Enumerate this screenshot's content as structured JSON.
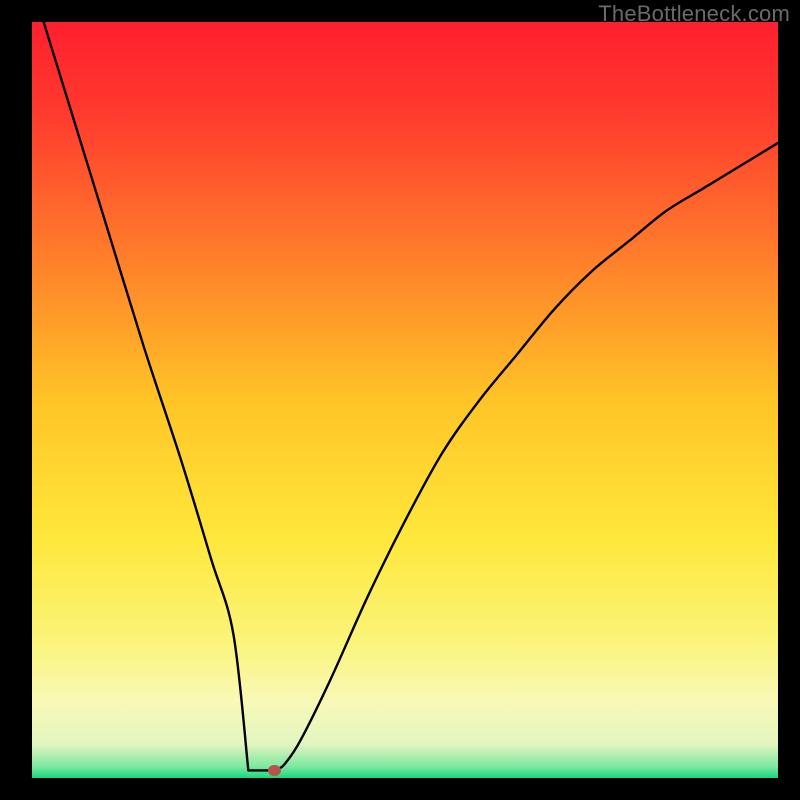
{
  "watermark": "TheBottleneck.com",
  "chart_data": {
    "type": "line",
    "title": "",
    "xlabel": "",
    "ylabel": "",
    "xlim": [
      0,
      100
    ],
    "ylim": [
      0,
      100
    ],
    "gradient_stops": [
      {
        "offset": 0.0,
        "color": "#ff1f2e"
      },
      {
        "offset": 0.12,
        "color": "#ff3a2e"
      },
      {
        "offset": 0.3,
        "color": "#ff7a2b"
      },
      {
        "offset": 0.5,
        "color": "#ffc427"
      },
      {
        "offset": 0.68,
        "color": "#ffe73a"
      },
      {
        "offset": 0.82,
        "color": "#fbf47a"
      },
      {
        "offset": 0.9,
        "color": "#f8f9b8"
      },
      {
        "offset": 0.955,
        "color": "#e3f5c0"
      },
      {
        "offset": 0.985,
        "color": "#7de8a0"
      },
      {
        "offset": 1.0,
        "color": "#17d880"
      }
    ],
    "series": [
      {
        "name": "curve",
        "x": [
          0,
          5,
          10,
          15,
          20,
          24,
          27,
          29,
          30,
          31,
          31.5,
          32,
          33,
          34,
          36,
          40,
          45,
          50,
          55,
          60,
          65,
          70,
          75,
          80,
          85,
          90,
          95,
          100
        ],
        "values": [
          105,
          89,
          73,
          57,
          42,
          29,
          19,
          11,
          6,
          3,
          1.5,
          1,
          1.2,
          2,
          5,
          13,
          24,
          34,
          43,
          50,
          56,
          62,
          67,
          71,
          75,
          78,
          81,
          84
        ]
      }
    ],
    "marker": {
      "x": 32.5,
      "y": 1.0,
      "color": "#b75349",
      "rx": 6.5,
      "ry": 5.5
    },
    "floor": {
      "x0": 29.0,
      "y0": 1.0,
      "x1": 32.0,
      "y1": 1.0
    }
  }
}
